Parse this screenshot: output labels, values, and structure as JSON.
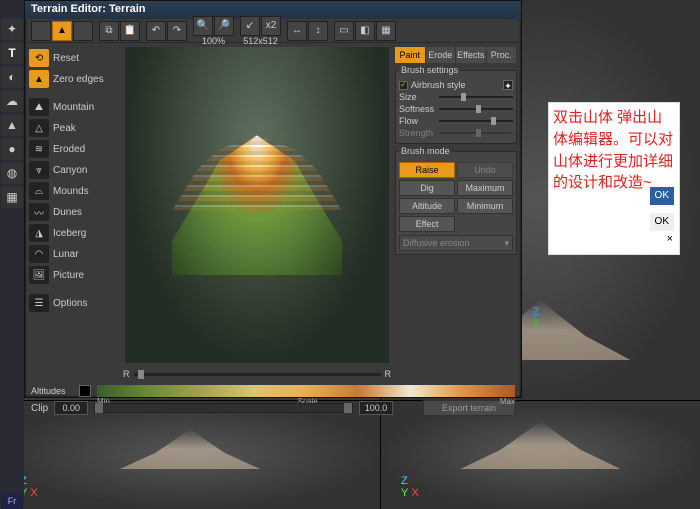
{
  "window": {
    "title": "Terrain Editor: Terrain"
  },
  "toolbar": {
    "zoom_pct": "100%",
    "size_mult": "x2",
    "resolution": "512x512"
  },
  "presets": {
    "reset": "Reset",
    "zero_edges": "Zero edges",
    "items": [
      {
        "label": "Mountain"
      },
      {
        "label": "Peak"
      },
      {
        "label": "Eroded"
      },
      {
        "label": "Canyon"
      },
      {
        "label": "Mounds"
      },
      {
        "label": "Dunes"
      },
      {
        "label": "Iceberg"
      },
      {
        "label": "Lunar"
      },
      {
        "label": "Picture"
      }
    ],
    "options": "Options"
  },
  "tabs": {
    "paint": "Paint",
    "erode": "Erode",
    "effects": "Effects",
    "proc": "Proc."
  },
  "brush": {
    "group_label": "Brush settings",
    "airbrush_label": "Airbrush style",
    "sliders": {
      "size": "Size",
      "softness": "Softness",
      "flow": "Flow",
      "strength": "Strength"
    }
  },
  "mode": {
    "group_label": "Brush mode",
    "raise": "Raise",
    "undo": "Undo",
    "dig": "Dig",
    "maximum": "Maximum",
    "altitude": "Altitude",
    "minimum": "Minimum",
    "effect": "Effect",
    "dropdown": "Diffusive erosion"
  },
  "footer": {
    "altitudes_lbl": "Altitudes",
    "min_lbl": "Min",
    "scale_lbl": "Scale",
    "max_lbl": "Max",
    "clip_lbl": "Clip",
    "clip_min": "0.00",
    "clip_max": "100.0",
    "export": "Export terrain"
  },
  "preview": {
    "slider_left": "R",
    "slider_right": "R"
  },
  "side_tabs": {
    "front": "Fr"
  },
  "annotation": {
    "text": "双击山体 弹出山体编辑器。可以对山体进行更加详细的设计和改造~",
    "ok": "OK",
    "ok2": "OK",
    "close": "×"
  },
  "gizmo": {
    "x": "X",
    "y": "Y",
    "z": "Z"
  }
}
